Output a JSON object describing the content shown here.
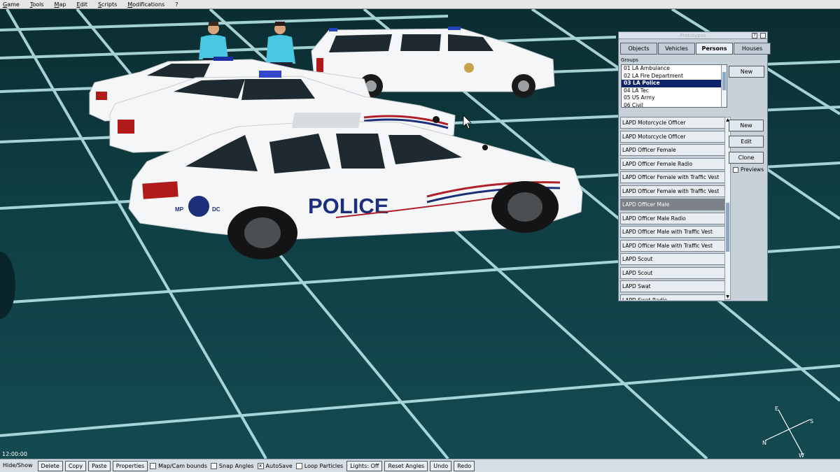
{
  "menu": [
    "Game",
    "Tools",
    "Map",
    "Edit",
    "Scripts",
    "Modifications",
    "?"
  ],
  "scene": {
    "car_text": "POLICE",
    "car_badge_left": "MP",
    "car_badge_right": "DC"
  },
  "panel": {
    "title": "Prototypes",
    "help_btn": "?",
    "tabs": [
      "Objects",
      "Vehicles",
      "Persons",
      "Houses"
    ],
    "active_tab": "Persons",
    "groups_label": "Groups",
    "groups": [
      "01 LA Ambulance",
      "02 LA Fire Department",
      "03 LA Police",
      "04 LA Tec",
      "05 US Army",
      "06 Civil"
    ],
    "selected_group": "03 LA Police",
    "group_new": "New",
    "items": [
      "LAPD Motorcycle Officer",
      "LAPD Motorcycle Officer",
      "LAPD Officer Female",
      "LAPD Officer Female Radio",
      "LAPD Officer Female with Traffic Vest",
      "LAPD Officer Female with Traffic Vest",
      "LAPD Officer Male",
      "LAPD Officer Male Radio",
      "LAPD Officer Male with Traffic Vest",
      "LAPD Officer Male with Traffic Vest",
      "LAPD Scout",
      "LAPD Scout",
      "LAPD Swat",
      "LAPD Swat Radio"
    ],
    "selected_item_index": 6,
    "btn_new": "New",
    "btn_edit": "Edit",
    "btn_clone": "Clone",
    "previews_label": "Previews"
  },
  "clock": "12:00:00",
  "toolbar": {
    "hide_show": "Hide/Show",
    "delete": "Delete",
    "copy": "Copy",
    "paste": "Paste",
    "properties": "Properties",
    "map_cam_bounds": "Map/Cam bounds",
    "snap_angles": "Snap Angles",
    "autosave": "AutoSave",
    "autosave_checked": "x",
    "loop_particles": "Loop Particles",
    "lights": "Lights: Off",
    "reset_angles": "Reset Angles",
    "undo": "Undo",
    "redo": "Redo"
  },
  "compass": {
    "n": "N",
    "e": "E",
    "s": "S",
    "w": "W"
  },
  "colors": {
    "ground": "#0f3b40",
    "grid": "#bfeef0",
    "selection": "#10246a",
    "car_body": "#f4f6f7",
    "police_blue": "#1c2f7a",
    "stripe_red": "#b0202a"
  }
}
